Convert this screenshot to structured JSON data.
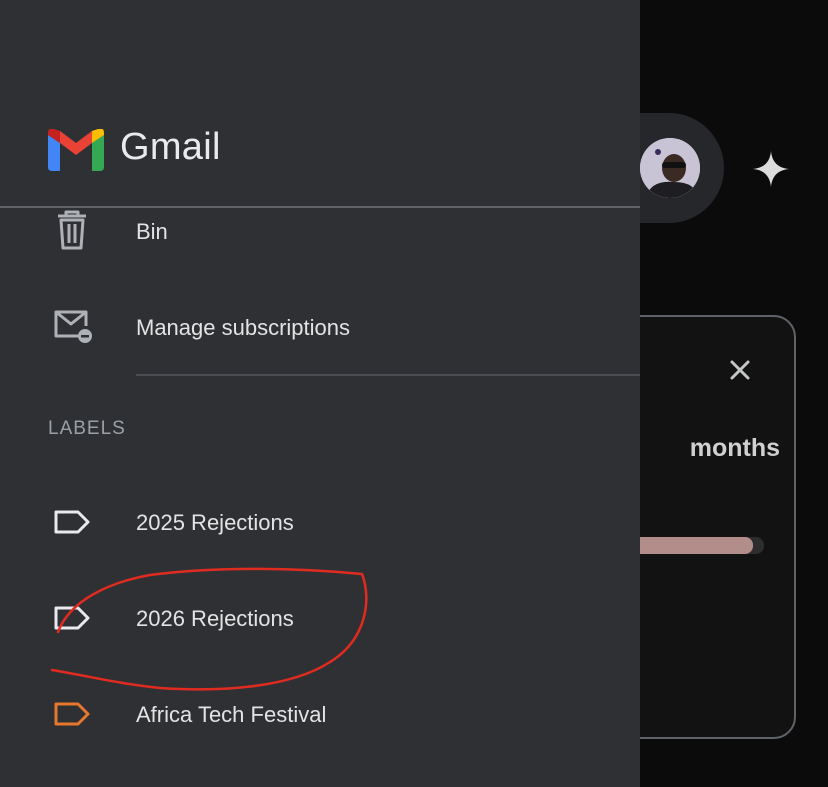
{
  "app": {
    "title": "Gmail"
  },
  "drawer": {
    "items": [
      {
        "label": "Bin",
        "icon": "trash-icon"
      },
      {
        "label": "Manage subscriptions",
        "icon": "manage-subscriptions-icon"
      }
    ],
    "labels_section": {
      "title": "LABELS",
      "labels": [
        {
          "label": "2025 Rejections",
          "icon": "label-icon",
          "color": "#e8eaed"
        },
        {
          "label": "2026 Rejections",
          "icon": "label-icon",
          "color": "#e8eaed"
        },
        {
          "label": "Africa Tech Festival",
          "icon": "label-icon",
          "color": "#e8772e"
        }
      ]
    }
  },
  "background": {
    "card_text": "months",
    "progress": 0.93,
    "progress_color": "#b38d8a"
  },
  "colors": {
    "drawer_bg": "#2e3034",
    "annotation": "#e02b20"
  }
}
